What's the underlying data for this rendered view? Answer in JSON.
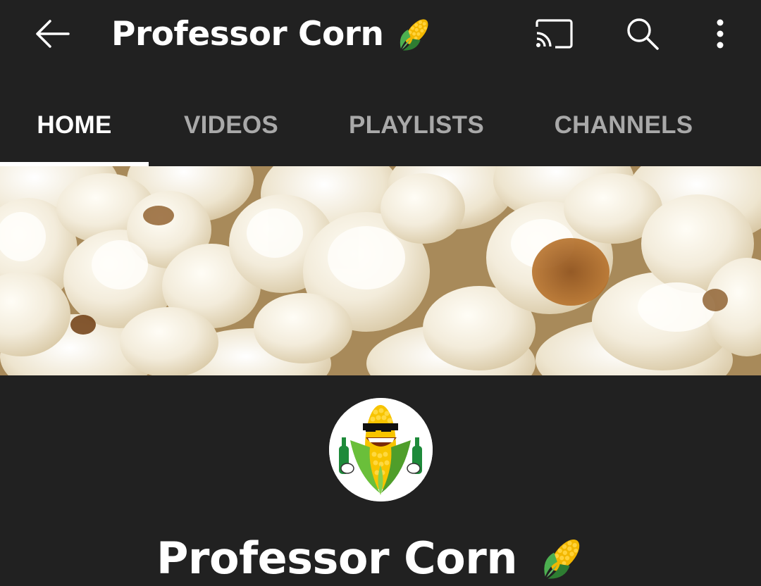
{
  "header": {
    "title": "Professor Corn",
    "title_emoji": "corn-icon",
    "icons": [
      "back-arrow-icon",
      "cast-icon",
      "search-icon",
      "more-vert-icon"
    ]
  },
  "tabs": [
    {
      "label": "HOME",
      "active": true
    },
    {
      "label": "VIDEOS",
      "active": false
    },
    {
      "label": "PLAYLISTS",
      "active": false
    },
    {
      "label": "CHANNELS",
      "active": false
    }
  ],
  "channel": {
    "name": "Professor Corn",
    "name_emoji": "corn-icon"
  },
  "colors": {
    "background": "#212121",
    "tab_active": "#ffffff",
    "tab_inactive": "#a9a9a9"
  }
}
